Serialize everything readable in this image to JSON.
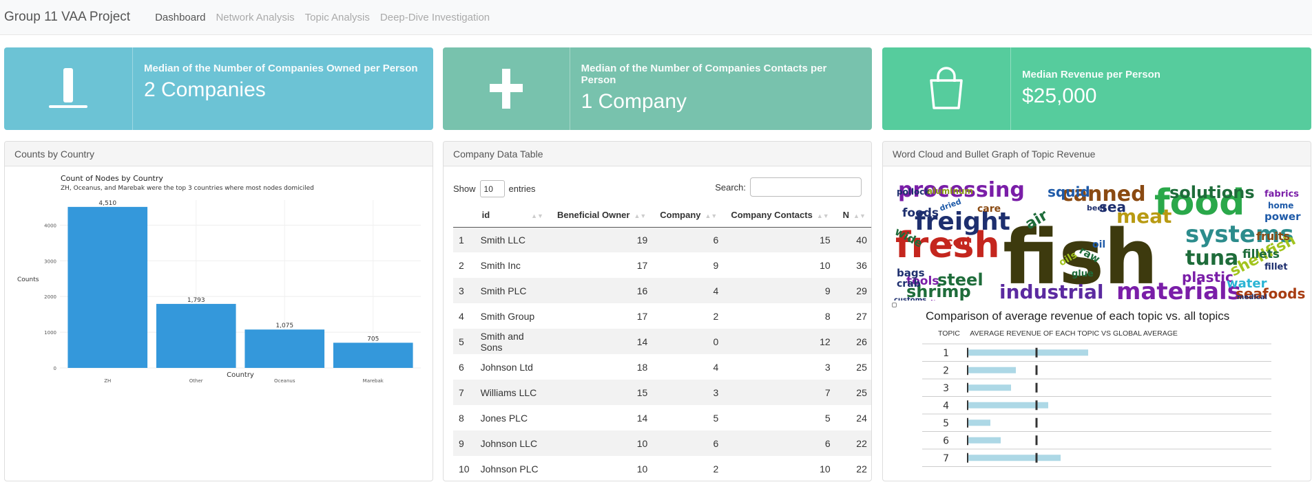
{
  "nav": {
    "brand": "Group 11 VAA Project",
    "links": [
      "Dashboard",
      "Network Analysis",
      "Topic Analysis",
      "Deep-Dive Investigation"
    ]
  },
  "valueboxes": [
    {
      "title": "Median of the Number of Companies Owned per Person",
      "value": "2 Companies",
      "icon": "person-standing-icon",
      "color": "#6cc3d5"
    },
    {
      "title": "Median of the Number of Companies Contacts per Person",
      "value": "1 Company",
      "icon": "plus-icon",
      "color": "#78c2ad"
    },
    {
      "title": "Median Revenue per Person",
      "value": "$25,000",
      "icon": "shopping-bag-icon",
      "color": "#56cc9d"
    }
  ],
  "cards": {
    "country": "Counts by Country",
    "table": "Company Data Table",
    "wordcloud": "Word Cloud and Bullet Graph of Topic Revenue"
  },
  "chart_data": [
    {
      "type": "bar",
      "title": "Count of Nodes by Country",
      "subtitle": "ZH, Oceanus, and Marebak were the top 3 countries where most nodes domiciled",
      "xlabel": "Country",
      "ylabel": "Counts",
      "categories": [
        "ZH",
        "Other",
        "Oceanus",
        "Marebak"
      ],
      "values": [
        4510,
        1793,
        1075,
        705
      ],
      "data_labels": [
        "4,510",
        "1,793",
        "1,075",
        "705"
      ],
      "yticks": [
        0,
        1000,
        2000,
        3000,
        4000
      ],
      "ylim": [
        0,
        4700
      ],
      "grid": true,
      "color": "#3498db"
    },
    {
      "type": "bar",
      "title": "Comparison of average revenue of each topic vs. all topics",
      "xlabel": "AVERAGE REVENUE OF EACH TOPIC VS GLOBAL AVERAGE",
      "ylabel": "TOPIC",
      "categories": [
        "1",
        "2",
        "3",
        "4",
        "5",
        "6",
        "7"
      ],
      "values": [
        1.75,
        0.7,
        0.63,
        1.17,
        0.33,
        0.48,
        1.35
      ],
      "reference": 1.0,
      "color": "#add8e6"
    }
  ],
  "table": {
    "show": "Show",
    "length": "10",
    "entries": "entries",
    "search": "Search:",
    "columns": [
      "",
      "id",
      "Beneficial Owner",
      "Company",
      "Company Contacts",
      "N"
    ],
    "rows": [
      [
        "1",
        "Smith LLC",
        "19",
        "6",
        "15",
        "40"
      ],
      [
        "2",
        "Smith Inc",
        "17",
        "9",
        "10",
        "36"
      ],
      [
        "3",
        "Smith PLC",
        "16",
        "4",
        "9",
        "29"
      ],
      [
        "4",
        "Smith Group",
        "17",
        "2",
        "8",
        "27"
      ],
      [
        "5",
        "Smith and Sons",
        "14",
        "0",
        "12",
        "26"
      ],
      [
        "6",
        "Johnson Ltd",
        "18",
        "4",
        "3",
        "25"
      ],
      [
        "7",
        "Williams LLC",
        "15",
        "3",
        "7",
        "25"
      ],
      [
        "8",
        "Jones PLC",
        "14",
        "5",
        "5",
        "24"
      ],
      [
        "9",
        "Johnson LLC",
        "10",
        "6",
        "6",
        "22"
      ],
      [
        "10",
        "Johnson PLC",
        "10",
        "2",
        "10",
        "22"
      ]
    ]
  },
  "wordcloud": {
    "words": [
      {
        "text": "fish",
        "color": "#3d3a0e"
      },
      {
        "text": "food",
        "color": "#2aa84a"
      },
      {
        "text": "fresh",
        "color": "#c4261e"
      },
      {
        "text": "freight",
        "color": "#1e2f6e"
      },
      {
        "text": "systems",
        "color": "#2c8c8c"
      },
      {
        "text": "materials",
        "color": "#7a1ea8"
      },
      {
        "text": "industrial",
        "color": "#5b2aa0"
      },
      {
        "text": "processing",
        "color": "#7a1ea8"
      },
      {
        "text": "canned",
        "color": "#8a4a12"
      },
      {
        "text": "solutions",
        "color": "#1e6c3a"
      },
      {
        "text": "meat",
        "color": "#b89a12"
      },
      {
        "text": "tuna",
        "color": "#1e6c3a"
      },
      {
        "text": "shellfish",
        "color": "#a2c41e"
      },
      {
        "text": "shrimp",
        "color": "#1e6c3a"
      },
      {
        "text": "steel",
        "color": "#1e6c3a"
      },
      {
        "text": "seafoods",
        "color": "#a83d12"
      },
      {
        "text": "plastic",
        "color": "#7a1ea8"
      },
      {
        "text": "water",
        "color": "#2ab4d4"
      },
      {
        "text": "tools",
        "color": "#7a1ea8"
      },
      {
        "text": "squid",
        "color": "#1e5aa8"
      },
      {
        "text": "sea",
        "color": "#1e2f6e"
      },
      {
        "text": "fillets",
        "color": "#1e6c3a"
      },
      {
        "text": "fruits",
        "color": "#8a4a12"
      },
      {
        "text": "air",
        "color": "#1e6c3a"
      },
      {
        "text": "foods",
        "color": "#1e2f6e"
      },
      {
        "text": "wide",
        "color": "#1e6c3a"
      },
      {
        "text": "cod",
        "color": "#c4261e"
      },
      {
        "text": "bags",
        "color": "#1e2f6e"
      },
      {
        "text": "crab",
        "color": "#1e2f6e"
      },
      {
        "text": "service",
        "color": "#7a1ea8"
      },
      {
        "text": "power",
        "color": "#1e5aa8"
      },
      {
        "text": "fabrics",
        "color": "#7a1ea8"
      },
      {
        "text": "pollock",
        "color": "#1e2f6e"
      },
      {
        "text": "aluminum",
        "color": "#8a9a12"
      },
      {
        "text": "oil",
        "color": "#1e5aa8"
      },
      {
        "text": "items",
        "color": "#7a1ea8"
      },
      {
        "text": "care",
        "color": "#8a4a12"
      },
      {
        "text": "fillet",
        "color": "#1e2f6e"
      },
      {
        "text": "home",
        "color": "#1e5aa8"
      },
      {
        "text": "glue",
        "color": "#1e6c3a"
      },
      {
        "text": "oils",
        "color": "#a2c41e"
      },
      {
        "text": "dried",
        "color": "#1e5aa8"
      },
      {
        "text": "beef",
        "color": "#1e2f6e"
      },
      {
        "text": "raw",
        "color": "#1e6c3a"
      },
      {
        "text": "medical",
        "color": "#1e2f6e"
      },
      {
        "text": "customs",
        "color": "#1e2f6e"
      }
    ]
  }
}
